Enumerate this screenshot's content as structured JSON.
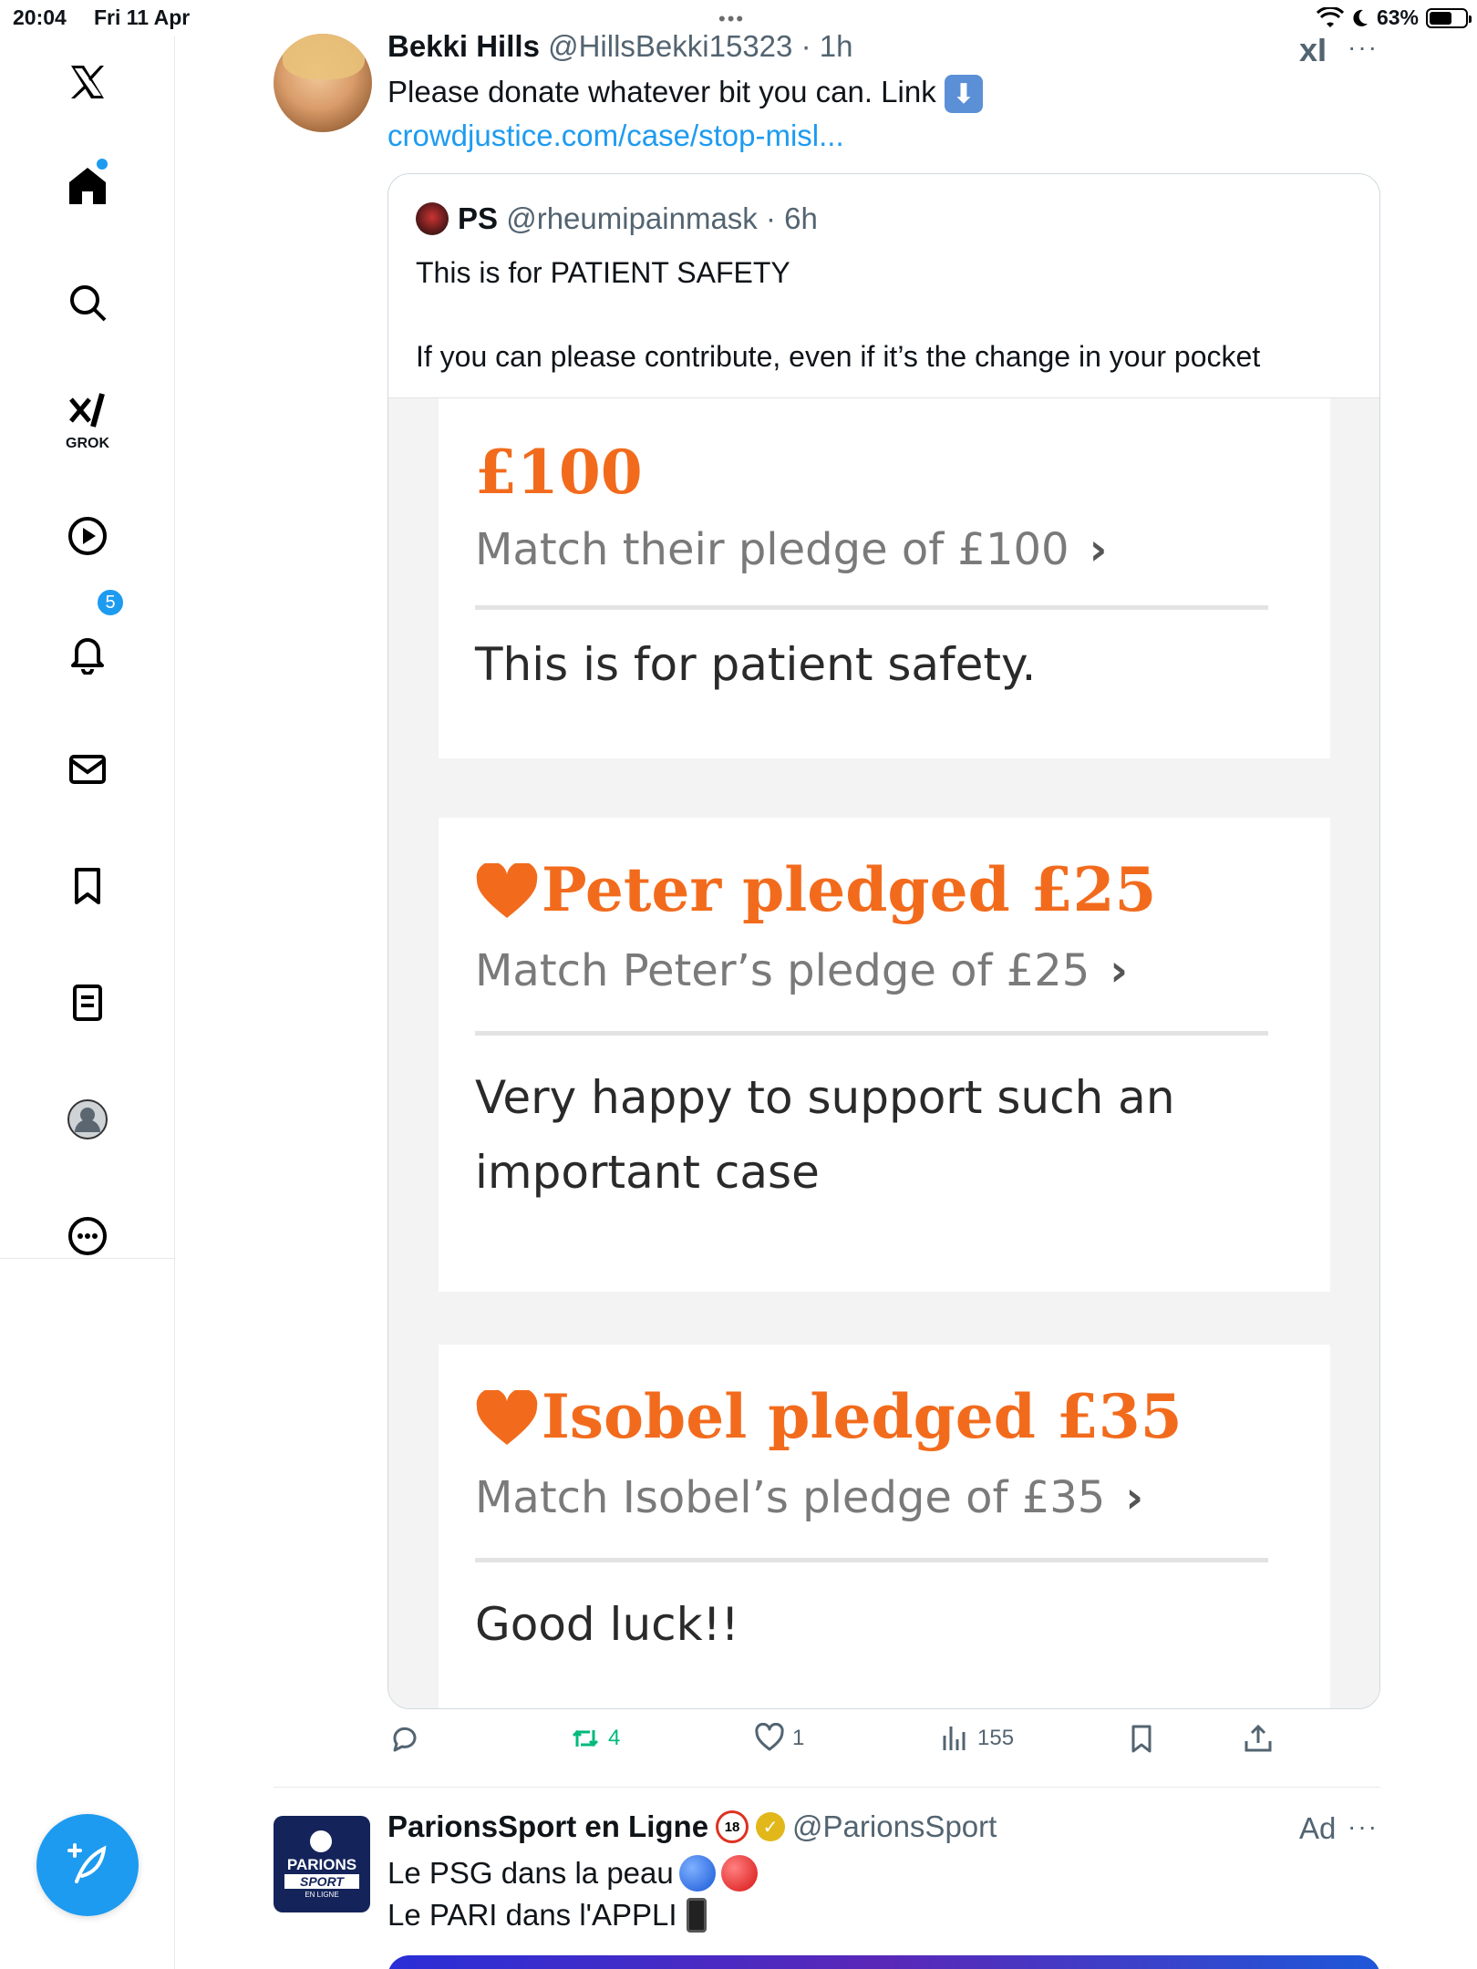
{
  "status_bar": {
    "time": "20:04",
    "date": "Fri 11 Apr",
    "battery": "63%",
    "battery_level": 0.63,
    "multitask_dots": "•••"
  },
  "sidebar": {
    "items": [
      {
        "icon": "x-logo-icon"
      },
      {
        "icon": "home-icon"
      },
      {
        "icon": "search-icon"
      },
      {
        "icon": "grok-icon",
        "label": "GROK"
      },
      {
        "icon": "video-icon"
      },
      {
        "icon": "bell-icon",
        "badge": "5"
      },
      {
        "icon": "mail-icon"
      },
      {
        "icon": "bookmark-icon"
      },
      {
        "icon": "list-icon"
      },
      {
        "icon": "profile-icon"
      },
      {
        "icon": "more-circle-icon"
      }
    ],
    "compose_icon": "compose-icon"
  },
  "tweet": {
    "name": "Bekki Hills",
    "handle": "@HillsBekki15323",
    "time": "· 1h",
    "text": "Please donate whatever bit you can. Link",
    "link_emoji": "⬇",
    "link": "crowdjustice.com/case/stop-misl...",
    "grok_icon": "xI",
    "more": "···",
    "quote": {
      "name": "PS",
      "handle": "@rheumipainmask",
      "time": "· 6h",
      "line1": "This is for PATIENT SAFETY",
      "line2": "If you can please contribute, even if it’s the change in your pocket",
      "image": {
        "cards": [
          {
            "amount": "£100",
            "match": "Match their pledge of £100",
            "message_lines": [
              "This is for patient safety."
            ]
          },
          {
            "amount": "Peter pledged £25",
            "match": "Match Peter’s pledge of £25",
            "message_lines": [
              "Very happy to support such an",
              "important case"
            ]
          },
          {
            "amount": "Isobel pledged £35",
            "match": "Match Isobel’s pledge of £35",
            "message_lines": [
              "Good luck!!"
            ]
          }
        ],
        "chevron": "›"
      }
    },
    "actions": {
      "replies": "",
      "retweets": "4",
      "likes": "1",
      "views": "155"
    },
    "accent_color": "#1d9bf0",
    "retweet_color": "#00ba7c"
  },
  "ad": {
    "name": "ParionsSport en Ligne",
    "age_badge": "18",
    "handle": "@ParionsSport",
    "tag": "Ad",
    "more": "···",
    "line1": "Le PSG dans la peau",
    "line2": "Le PARI dans l'APPLI",
    "logo_lines": [
      "PARIONS",
      "SPORT",
      "EN LIGNE"
    ]
  }
}
